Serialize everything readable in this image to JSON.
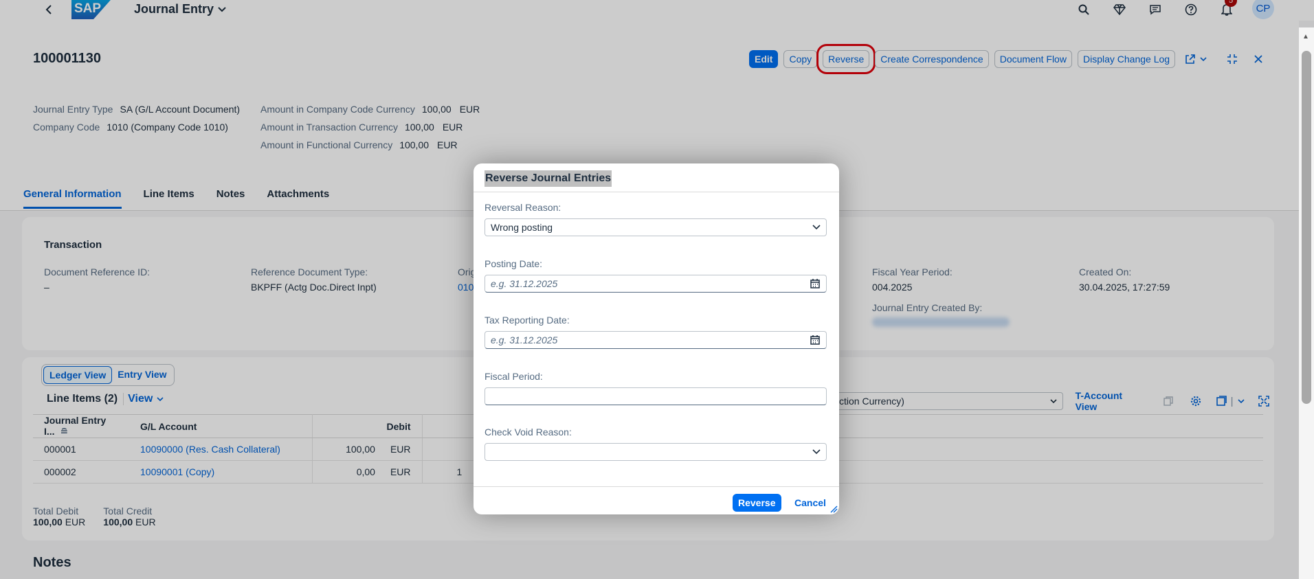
{
  "shell": {
    "app_title": "Journal Entry",
    "notification_count": "5",
    "user_initials": "CP"
  },
  "header": {
    "document_number": "100001130",
    "actions": {
      "edit": "Edit",
      "copy": "Copy",
      "reverse": "Reverse",
      "create_correspondence": "Create Correspondence",
      "document_flow": "Document Flow",
      "display_change_log": "Display Change Log"
    },
    "attributes": [
      {
        "label": "Journal Entry Type",
        "value": "SA (G/L Account Document)"
      },
      {
        "label": "Company Code",
        "value": "1010 (Company Code 1010)"
      }
    ],
    "amounts": [
      {
        "label": "Amount in Company Code Currency",
        "value": "100,00",
        "currency": "EUR"
      },
      {
        "label": "Amount in Transaction Currency",
        "value": "100,00",
        "currency": "EUR"
      },
      {
        "label": "Amount in Functional Currency",
        "value": "100,00",
        "currency": "EUR"
      }
    ]
  },
  "tabs": [
    "General Information",
    "Line Items",
    "Notes",
    "Attachments"
  ],
  "transaction": {
    "title": "Transaction",
    "doc_ref_label": "Document Reference ID:",
    "doc_ref_value": "–",
    "ref_doc_type_label": "Reference Document Type:",
    "ref_doc_type_value": "BKPFF (Actg Doc.Direct Inpt)",
    "orig_label": "Orig",
    "orig_value": "010",
    "fiscal_year_period_label": "Fiscal Year Period:",
    "fiscal_year_period_value": "004.2025",
    "created_on_label": "Created On:",
    "created_on_value": "30.04.2025, 17:27:59",
    "created_by_label": "Journal Entry Created By:"
  },
  "line_items": {
    "seg_ledger": "Ledger View",
    "seg_entry": "Entry View",
    "title": "Line Items (2)",
    "view_label": "View",
    "currency_select": "ction Currency)",
    "t_account_view": "T-Account View",
    "columns": [
      "Journal Entry I...",
      "G/L Account",
      "Debit",
      ""
    ],
    "rows": [
      {
        "item": "000001",
        "account": "10090000 (Res. Cash Collateral)",
        "debit": "100,00",
        "cur": "EUR",
        "extra": ""
      },
      {
        "item": "000002",
        "account": "10090001 (Copy)",
        "debit": "0,00",
        "cur": "EUR",
        "extra": "1"
      }
    ],
    "total_debit_label": "Total Debit",
    "total_debit_value": "100,00",
    "total_debit_cur": "EUR",
    "total_credit_label": "Total Credit",
    "total_credit_value": "100,00",
    "total_credit_cur": "EUR"
  },
  "notes_heading": "Notes",
  "dialog": {
    "title": "Reverse Journal Entries",
    "reversal_reason_label": "Reversal Reason:",
    "reversal_reason_value": "Wrong posting",
    "posting_date_label": "Posting Date:",
    "posting_date_placeholder": "e.g. 31.12.2025",
    "tax_reporting_date_label": "Tax Reporting Date:",
    "tax_reporting_date_placeholder": "e.g. 31.12.2025",
    "fiscal_period_label": "Fiscal Period:",
    "fiscal_period_value": "",
    "check_void_reason_label": "Check Void Reason:",
    "check_void_reason_value": "",
    "reverse_button": "Reverse",
    "cancel_button": "Cancel"
  },
  "colors": {
    "accent": "#0070f2",
    "link": "#0064d9",
    "highlight": "#e0000b"
  }
}
